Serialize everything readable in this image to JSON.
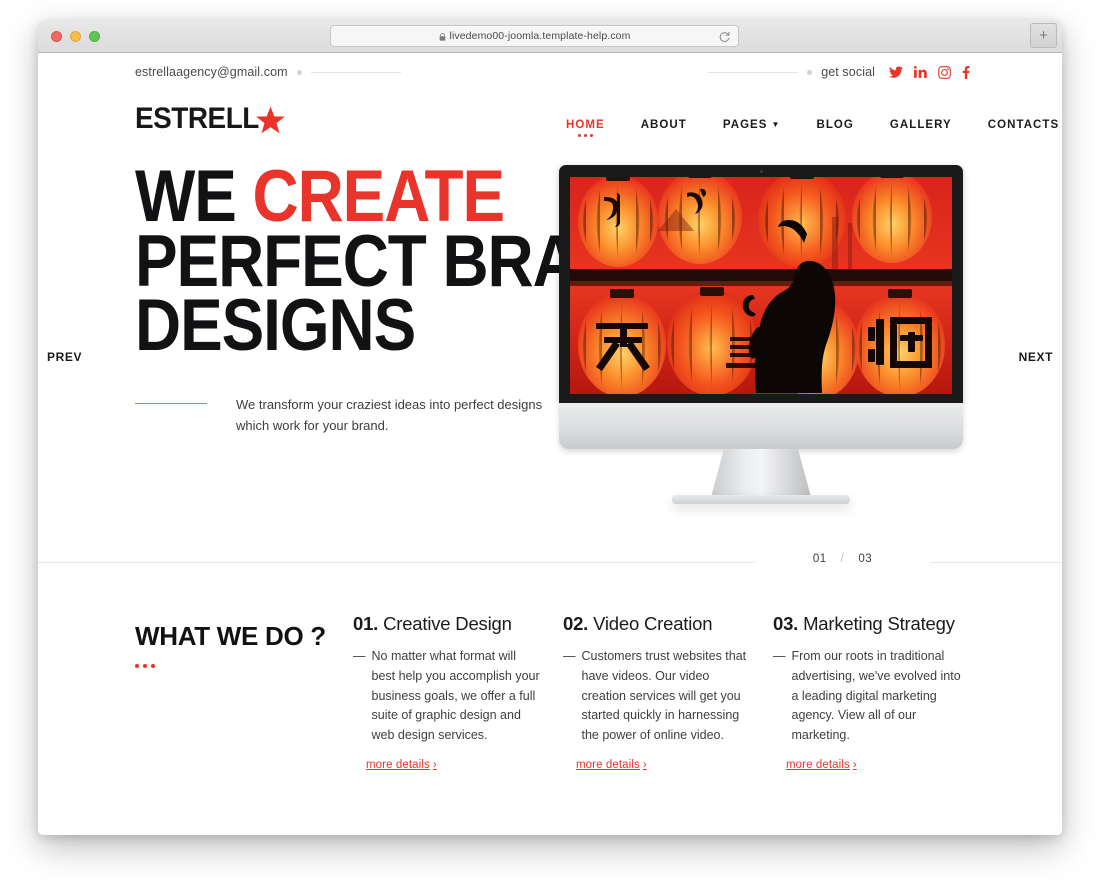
{
  "browser": {
    "url": "livedemo00-joomla.template-help.com",
    "lock_icon": "lock-icon",
    "reload_icon": "reload-icon",
    "new_tab_label": "+",
    "traffic_lights": [
      "close-red",
      "minimize-yellow",
      "zoom-green"
    ]
  },
  "topbar": {
    "email": "estrellaagency@gmail.com",
    "social_label": "get social",
    "social": [
      {
        "name": "twitter-icon",
        "color": "#e8342a"
      },
      {
        "name": "linkedin-icon",
        "color": "#e8342a"
      },
      {
        "name": "instagram-icon",
        "color": "#e8342a"
      },
      {
        "name": "facebook-icon",
        "color": "#e8342a"
      }
    ]
  },
  "header": {
    "logo_text": "ESTRELL",
    "logo_star_icon": "star-icon",
    "nav": [
      {
        "label": "HOME",
        "active": true,
        "dropdown": false
      },
      {
        "label": "ABOUT",
        "active": false,
        "dropdown": false
      },
      {
        "label": "PAGES",
        "active": false,
        "dropdown": true
      },
      {
        "label": "BLOG",
        "active": false,
        "dropdown": false
      },
      {
        "label": "GALLERY",
        "active": false,
        "dropdown": false
      },
      {
        "label": "CONTACTS",
        "active": false,
        "dropdown": false
      }
    ]
  },
  "hero": {
    "prev_label": "PREV",
    "next_label": "NEXT",
    "headline_line1_plain": "WE ",
    "headline_line1_accent": "CREATE",
    "headline_line2": "PERFECT BRAND",
    "headline_line3": "DESIGNS",
    "subtitle": "We transform your craziest ideas into perfect designs which work for your brand.",
    "slide_current": "01",
    "slide_separator": "/",
    "slide_total": "03",
    "image_alt": "red-paper-lanterns-silhouette",
    "accent_color": "#e8342a"
  },
  "services": {
    "heading": "WHAT WE DO ?",
    "cards": [
      {
        "number": "01.",
        "title": "Creative Design",
        "dash": "—",
        "body": "No matter what format will best help you accomplish your business goals, we offer a full suite of graphic design and web design services.",
        "link": "more details",
        "link_chevron": "›"
      },
      {
        "number": "02.",
        "title": "Video Creation",
        "dash": "—",
        "body": "Customers trust websites that have videos. Our video creation services will get you started quickly in harnessing the power of online video.",
        "link": "more details",
        "link_chevron": "›"
      },
      {
        "number": "03.",
        "title": "Marketing Strategy",
        "dash": "—",
        "body": "From our roots in traditional advertising, we've evolved into a leading digital marketing agency. View all of our marketing.",
        "link": "more details",
        "link_chevron": "›"
      }
    ]
  }
}
